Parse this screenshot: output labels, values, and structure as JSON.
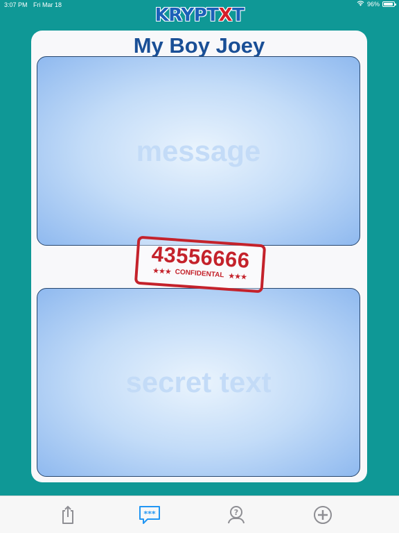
{
  "status_bar": {
    "time": "3:07 PM",
    "date": "Fri Mar 18",
    "battery": "96%",
    "battery_level": 0.96,
    "icons": [
      "wifi-icon",
      "battery-icon"
    ]
  },
  "app": {
    "logo_parts": [
      "KRYPT",
      "X",
      "T"
    ]
  },
  "card": {
    "title": "My Boy Joey",
    "message_placeholder": "message",
    "secret_placeholder": "secret text"
  },
  "stamp": {
    "number": "43556666",
    "label": "CONFIDENTAL",
    "stars_left": "★★★",
    "stars_right": "★★★"
  },
  "tab_bar": {
    "tabs": [
      {
        "icon": "share-icon",
        "selected": false
      },
      {
        "icon": "message-icon",
        "selected": true
      },
      {
        "icon": "help-icon",
        "selected": false
      },
      {
        "icon": "add-icon",
        "selected": false
      }
    ]
  },
  "colors": {
    "background": "#0f9896",
    "accent": "#1a4f96",
    "stamp": "#c4222b",
    "tab_selected": "#2196f3",
    "tab_inactive": "#8e8e93"
  }
}
